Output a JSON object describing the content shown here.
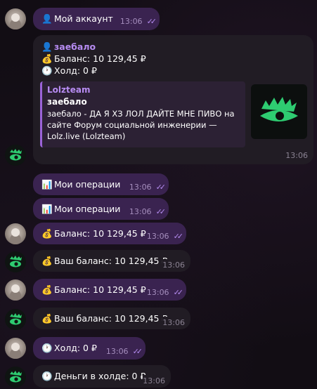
{
  "messages": [
    {
      "text": "Мой аккаунт",
      "time": "13:06"
    },
    {
      "text": "Мои операции",
      "time": "13:06"
    },
    {
      "text": "Мои операции",
      "time": "13:06"
    },
    {
      "text": "Баланс: 10 129,45 ₽",
      "time": "13:06"
    },
    {
      "text": "Ваш баланс: 10 129,45 ₽",
      "time": "13:06"
    },
    {
      "text": "Баланс: 10 129,45 ₽",
      "time": "13:06"
    },
    {
      "text": "Ваш баланс: 10 129,45 ₽",
      "time": "13:06"
    },
    {
      "text": "Холд: 0 ₽",
      "time": "13:06"
    },
    {
      "text": "Деньги в холде: 0 ₽",
      "time": "13:06"
    }
  ],
  "account_card": {
    "username": "заебало",
    "balance": "Баланс: 10 129,45 ₽",
    "hold": "Холд: 0 ₽",
    "time": "13:06",
    "preview": {
      "site": "Lolzteam",
      "title": "заебало",
      "description": "заебало - ДА Я ХЗ ЛОЛ ДАЙТЕ МНЕ ПИВО  на сайте Форум социальной инженерии — Lolz.live (Lolzteam)"
    }
  },
  "icons": {
    "person": "bust-icon",
    "moneybag": "money-bag-icon",
    "clock": "clock-icon",
    "chart": "bar-chart-icon"
  },
  "colors": {
    "outgoing": "#3a2350",
    "incoming": "#211c24",
    "accent": "#b58cf0",
    "logo": "#2ecc71"
  }
}
